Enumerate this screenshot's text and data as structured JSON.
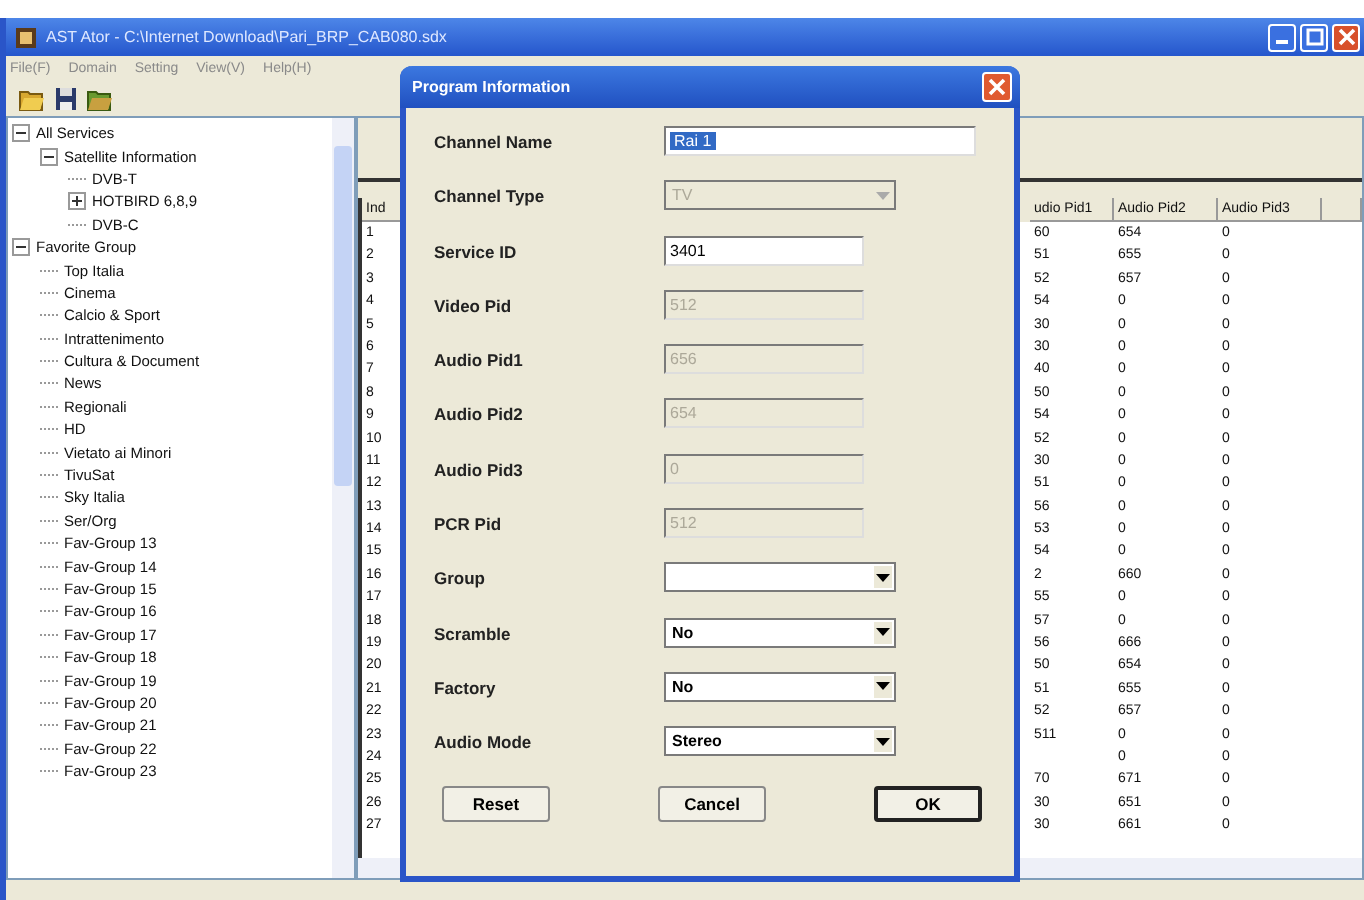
{
  "window": {
    "title": "AST Ator - C:\\Internet Download\\Pari_BRP_CAB080.sdx"
  },
  "menu": [
    "File(F)",
    "Domain",
    "Setting",
    "View(V)",
    "Help(H)"
  ],
  "tree": [
    {
      "label": "All Services",
      "expanded": true,
      "children": [
        {
          "label": "Satellite Information",
          "expanded": true,
          "children": [
            {
              "label": "DVB-T"
            },
            {
              "label": "HOTBIRD 6,8,9",
              "expanded": false
            },
            {
              "label": "DVB-C"
            }
          ]
        }
      ]
    },
    {
      "label": "Favorite Group",
      "expanded": true,
      "children": [
        {
          "label": "Top Italia"
        },
        {
          "label": "Cinema"
        },
        {
          "label": "Calcio & Sport"
        },
        {
          "label": "Intrattenimento"
        },
        {
          "label": "Cultura & Document"
        },
        {
          "label": "News"
        },
        {
          "label": "Regionali"
        },
        {
          "label": "HD"
        },
        {
          "label": "Vietato ai Minori"
        },
        {
          "label": "TivuSat"
        },
        {
          "label": "Sky Italia"
        },
        {
          "label": "Ser/Org"
        },
        {
          "label": "Fav-Group 13"
        },
        {
          "label": "Fav-Group 14"
        },
        {
          "label": "Fav-Group 15"
        },
        {
          "label": "Fav-Group 16"
        },
        {
          "label": "Fav-Group 17"
        },
        {
          "label": "Fav-Group 18"
        },
        {
          "label": "Fav-Group 19"
        },
        {
          "label": "Fav-Group 20"
        },
        {
          "label": "Fav-Group 21"
        },
        {
          "label": "Fav-Group 22"
        },
        {
          "label": "Fav-Group 23"
        }
      ]
    }
  ],
  "table": {
    "columns": [
      "Ind",
      "udio Pid1",
      "Audio Pid2",
      "Audio Pid3"
    ],
    "rows": [
      [
        "1",
        "60",
        "654",
        "0"
      ],
      [
        "2",
        "51",
        "655",
        "0"
      ],
      [
        "3",
        "52",
        "657",
        "0"
      ],
      [
        "4",
        "54",
        "0",
        "0"
      ],
      [
        "5",
        "30",
        "0",
        "0"
      ],
      [
        "6",
        "30",
        "0",
        "0"
      ],
      [
        "7",
        "40",
        "0",
        "0"
      ],
      [
        "8",
        "50",
        "0",
        "0"
      ],
      [
        "9",
        "54",
        "0",
        "0"
      ],
      [
        "10",
        "52",
        "0",
        "0"
      ],
      [
        "11",
        "30",
        "0",
        "0"
      ],
      [
        "12",
        "51",
        "0",
        "0"
      ],
      [
        "13",
        "56",
        "0",
        "0"
      ],
      [
        "14",
        "53",
        "0",
        "0"
      ],
      [
        "15",
        "54",
        "0",
        "0"
      ],
      [
        "16",
        "2",
        "660",
        "0"
      ],
      [
        "17",
        "55",
        "0",
        "0"
      ],
      [
        "18",
        "57",
        "0",
        "0"
      ],
      [
        "19",
        "56",
        "666",
        "0"
      ],
      [
        "20",
        "50",
        "654",
        "0"
      ],
      [
        "21",
        "51",
        "655",
        "0"
      ],
      [
        "22",
        "52",
        "657",
        "0"
      ],
      [
        "23",
        "511",
        "0",
        "0"
      ],
      [
        "24",
        "",
        "0",
        "0"
      ],
      [
        "25",
        "70",
        "671",
        "0"
      ],
      [
        "26",
        "30",
        "651",
        "0"
      ],
      [
        "27",
        "30",
        "661",
        "0"
      ]
    ]
  },
  "dialog": {
    "title": "Program Information",
    "fields": [
      {
        "label": "Channel Name",
        "kind": "text",
        "value": "Rai 1",
        "selected": true,
        "disabled": false,
        "wide": true
      },
      {
        "label": "Channel Type",
        "kind": "combo",
        "value": "TV",
        "disabled": true
      },
      {
        "label": "Service ID",
        "kind": "text",
        "value": "3401",
        "selected": false,
        "disabled": false
      },
      {
        "label": "Video Pid",
        "kind": "text",
        "value": "512",
        "selected": false,
        "disabled": true
      },
      {
        "label": "Audio Pid1",
        "kind": "text",
        "value": "656",
        "selected": false,
        "disabled": true
      },
      {
        "label": "Audio Pid2",
        "kind": "text",
        "value": "654",
        "selected": false,
        "disabled": true
      },
      {
        "label": "Audio Pid3",
        "kind": "text",
        "value": "0",
        "selected": false,
        "disabled": true
      },
      {
        "label": "PCR Pid",
        "kind": "text",
        "value": "512",
        "selected": false,
        "disabled": true
      },
      {
        "label": "Group",
        "kind": "combo",
        "disabled": false
      },
      {
        "label": "Scramble",
        "kind": "combo",
        "value": "No",
        "disabled": false
      },
      {
        "label": "Factory",
        "kind": "combo",
        "value": "No",
        "disabled": false
      },
      {
        "label": "Audio Mode",
        "kind": "combo",
        "value": "Stereo",
        "disabled": false
      }
    ],
    "buttons": [
      {
        "label": "Reset",
        "default": false
      },
      {
        "label": "Cancel",
        "default": false
      },
      {
        "label": "OK",
        "default": true
      }
    ]
  }
}
